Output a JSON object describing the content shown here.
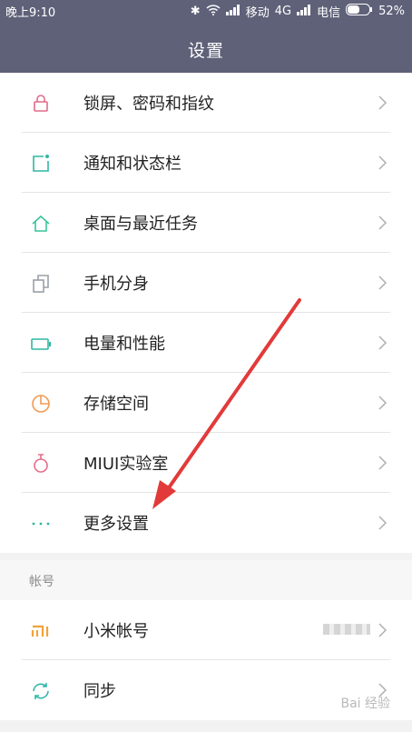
{
  "status_bar": {
    "time": "晚上9:10",
    "carrier1": "移动",
    "network": "4G",
    "carrier2": "电信",
    "battery": "52%"
  },
  "header": {
    "title": "设置"
  },
  "items": [
    {
      "label": "锁屏、密码和指纹",
      "icon": "lock-icon"
    },
    {
      "label": "通知和状态栏",
      "icon": "notification-icon"
    },
    {
      "label": "桌面与最近任务",
      "icon": "home-icon"
    },
    {
      "label": "手机分身",
      "icon": "clone-icon"
    },
    {
      "label": "电量和性能",
      "icon": "battery-icon"
    },
    {
      "label": "存储空间",
      "icon": "storage-pie-icon"
    },
    {
      "label": "MIUI实验室",
      "icon": "flask-icon"
    },
    {
      "label": "更多设置",
      "icon": "more-dots-icon"
    }
  ],
  "account_section": {
    "header": "帐号",
    "items": [
      {
        "label": "小米帐号",
        "icon": "mi-logo-icon"
      },
      {
        "label": "同步",
        "icon": "sync-icon"
      }
    ]
  },
  "watermark": "Bai 经验",
  "colors": {
    "header_bg": "#5e6178",
    "lock": "#e06b88",
    "notification": "#2fb7a2",
    "home": "#3cc39a",
    "clone": "#9aa0a8",
    "battery": "#2fb7a2",
    "storage": "#f09a55",
    "flask": "#e46e8a",
    "mi": "#f2a33a",
    "sync": "#34b7a8",
    "arrow": "#e23a3a"
  }
}
